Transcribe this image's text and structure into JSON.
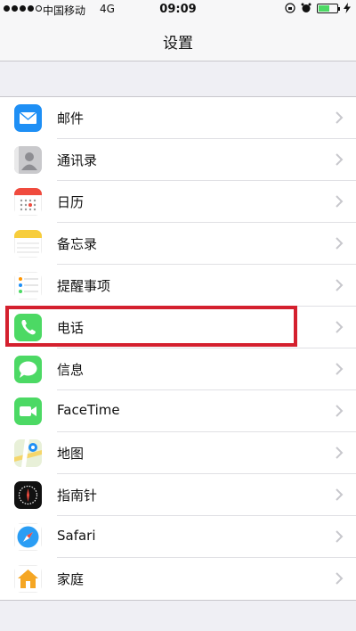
{
  "status_bar": {
    "carrier": "中国移动",
    "network": "4G",
    "time": "09:09",
    "battery_level": 0.6,
    "icons": [
      "rotation-lock-icon",
      "alarm-icon",
      "battery-icon",
      "charging-bolt-icon"
    ]
  },
  "nav": {
    "title": "设置"
  },
  "rows": [
    {
      "label": "邮件",
      "icon": "mail-icon"
    },
    {
      "label": "通讯录",
      "icon": "contacts-icon"
    },
    {
      "label": "日历",
      "icon": "calendar-icon"
    },
    {
      "label": "备忘录",
      "icon": "notes-icon"
    },
    {
      "label": "提醒事项",
      "icon": "reminders-icon"
    },
    {
      "label": "电话",
      "icon": "phone-icon"
    },
    {
      "label": "信息",
      "icon": "messages-icon"
    },
    {
      "label": "FaceTime",
      "icon": "facetime-icon"
    },
    {
      "label": "地图",
      "icon": "maps-icon"
    },
    {
      "label": "指南针",
      "icon": "compass-icon"
    },
    {
      "label": "Safari",
      "icon": "safari-icon"
    },
    {
      "label": "家庭",
      "icon": "home-icon"
    }
  ],
  "highlighted_row": "电话",
  "colors": {
    "highlight": "#d4202e",
    "background": "#efeff4",
    "chevron": "#c7c7cc"
  }
}
